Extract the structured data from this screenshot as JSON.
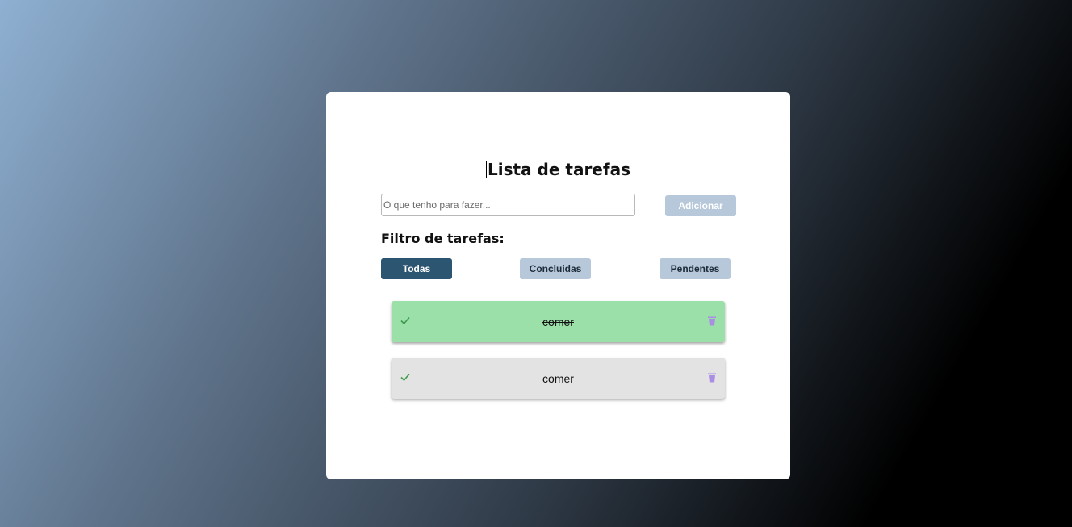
{
  "app": {
    "title": "Lista de tarefas"
  },
  "input": {
    "value": "",
    "placeholder": "O que tenho para fazer..."
  },
  "add_button": {
    "label": "Adicionar"
  },
  "filter": {
    "label": "Filtro de tarefas:",
    "buttons": [
      {
        "label": "Todas",
        "active": true
      },
      {
        "label": "Concluidas",
        "active": false
      },
      {
        "label": "Pendentes",
        "active": false
      }
    ]
  },
  "tasks": [
    {
      "text": "comer",
      "completed": true
    },
    {
      "text": "comer",
      "completed": false
    }
  ],
  "icons": {
    "check": "check-icon",
    "delete": "trash-icon"
  },
  "colors": {
    "primary": "#2b5570",
    "button_light": "#b6c8da",
    "completed_bg": "#9ce0a9",
    "pending_bg": "#e3e3e3",
    "check": "#3d9a4d",
    "trash": "#a98ee3"
  }
}
